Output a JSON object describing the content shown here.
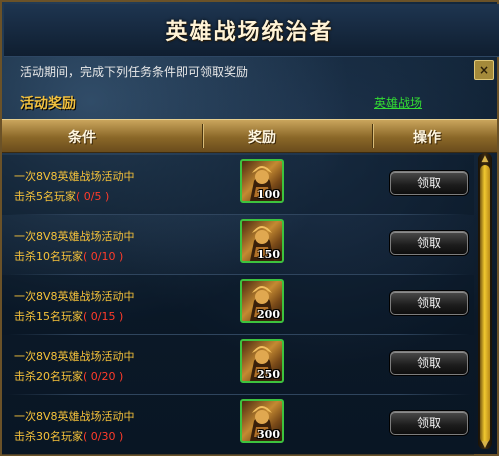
{
  "window": {
    "title": "英雄战场统治者",
    "close_label": "×"
  },
  "description": "活动期间，完成下列任务条件即可领取奖励",
  "section": {
    "title": "活动奖励",
    "link": "英雄战场"
  },
  "table": {
    "headers": [
      "条件",
      "奖励",
      "操作"
    ],
    "rows": [
      {
        "line1": "一次8V8英雄战场活动中",
        "line2": "击杀5名玩家",
        "progress": "( 0/5 )",
        "reward_count": "100",
        "button": "领取"
      },
      {
        "line1": "一次8V8英雄战场活动中",
        "line2": "击杀10名玩家",
        "progress": "( 0/10 )",
        "reward_count": "150",
        "button": "领取"
      },
      {
        "line1": "一次8V8英雄战场活动中",
        "line2": "击杀15名玩家",
        "progress": "( 0/15 )",
        "reward_count": "200",
        "button": "领取"
      },
      {
        "line1": "一次8V8英雄战场活动中",
        "line2": "击杀20名玩家",
        "progress": "( 0/20 )",
        "reward_count": "250",
        "button": "领取"
      },
      {
        "line1": "一次8V8英雄战场活动中",
        "line2": "击杀30名玩家",
        "progress": "( 0/30 )",
        "reward_count": "300",
        "button": "领取"
      }
    ]
  },
  "colors": {
    "condition_text": "#f6c23a",
    "progress_text": "#ff3b2a",
    "link": "#33dd33",
    "reward_border": "#3ec23e"
  },
  "icons": {
    "reward": "warrior-portrait-icon",
    "close": "close-icon"
  }
}
